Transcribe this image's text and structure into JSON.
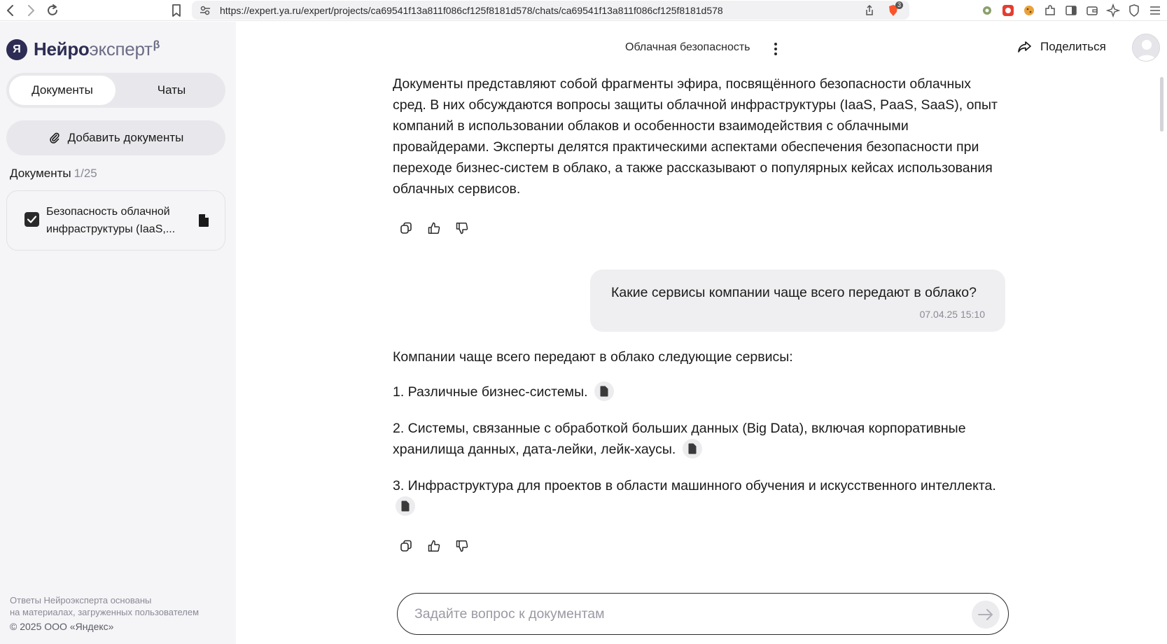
{
  "browser": {
    "url": "https://expert.ya.ru/expert/projects/ca69541f13a811f086cf125f8181d578/chats/ca69541f13a811f086cf125f8181d578",
    "brave_badge": "3"
  },
  "sidebar": {
    "logo_letter": "Я",
    "logo_part1": "Нейро",
    "logo_part2": "эксперт",
    "logo_beta": "β",
    "tabs": [
      {
        "label": "Документы",
        "active": true
      },
      {
        "label": "Чаты",
        "active": false
      }
    ],
    "add_documents_label": "Добавить документы",
    "documents_heading": "Документы",
    "documents_count": "1/25",
    "documents": [
      {
        "title": "Безопасность облачной инфраструктуры (IaaS,...",
        "checked": true
      }
    ],
    "footer_line1": "Ответы Нейроэксперта основаны",
    "footer_line2": "на материалах, загруженных пользователем",
    "copyright": "©  2025 ООО «Яндекс»"
  },
  "header": {
    "chat_title": "Облачная безопасность",
    "share_label": "Поделиться"
  },
  "messages": {
    "summary": "Документы представляют собой фрагменты эфира, посвящённого безопасности облачных сред. В них обсуждаются вопросы защиты облачной инфраструктуры (IaaS, PaaS, SaaS), опыт компаний в использовании облаков и особенности взаимодействия с облачными провайдерами. Эксперты делятся практическими аспектами обеспечения безопасности при переходе бизнес-систем в облако, а также рассказывают о популярных кейсах использования облачных сервисов.",
    "user_question": "Какие сервисы компании чаще всего передают в облако?",
    "user_time": "07.04.25 15:10",
    "answer_intro": "Компании чаще всего передают в облако следующие сервисы:",
    "answer_items": [
      "1. Различные бизнес-системы.",
      "2. Системы, связанные с обработкой больших данных (Big Data), включая корпоративные хранилища данных, дата-лейки, лейк-хаусы.",
      "3. Инфраструктура для проектов в области машинного обучения и искусственного интеллекта."
    ]
  },
  "composer": {
    "placeholder": "Задайте вопрос к документам"
  },
  "colors": {
    "sidebar_bg": "#f5f5f7",
    "pill_bg": "#e8e8ec",
    "bubble_bg": "#efeff1",
    "logo_dark": "#2c2c54",
    "logo_muted": "#6c6c86"
  }
}
